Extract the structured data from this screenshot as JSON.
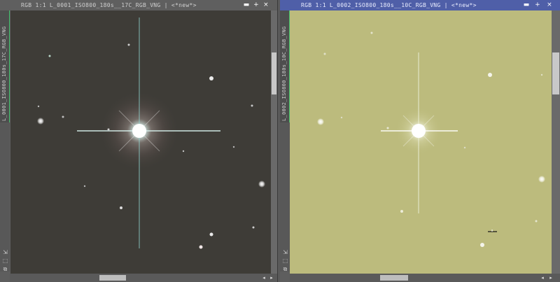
{
  "windows": [
    {
      "title": "RGB 1:1 L_0001_ISO800_180s__17C_RGB_VNG | <*new*>",
      "vertical_tab": "L_0001_ISO800_180s_17C_RGB_VNG",
      "controls": {
        "minimize": "▬",
        "maximize": "+",
        "close": "×"
      },
      "active": false,
      "background_color": "#3e3c37"
    },
    {
      "title": "RGB 1:1 L_0002_ISO800_180s__10C_RGB_VNG | <*new*>",
      "vertical_tab": "L_0002_ISO800_180s_10C_RGB_VNG",
      "controls": {
        "minimize": "▬",
        "maximize": "+",
        "close": "×"
      },
      "active": true,
      "background_color": "#bcbb7d"
    }
  ],
  "icons": {
    "scroll_left": "◂",
    "scroll_right": "▸",
    "tools": [
      "⇲",
      "⬚",
      "⧉"
    ]
  },
  "colors": {
    "active_titlebar": "#4f5fa8",
    "inactive_titlebar": "#5f5f5f",
    "tab_accent": "#3fbf6a"
  }
}
